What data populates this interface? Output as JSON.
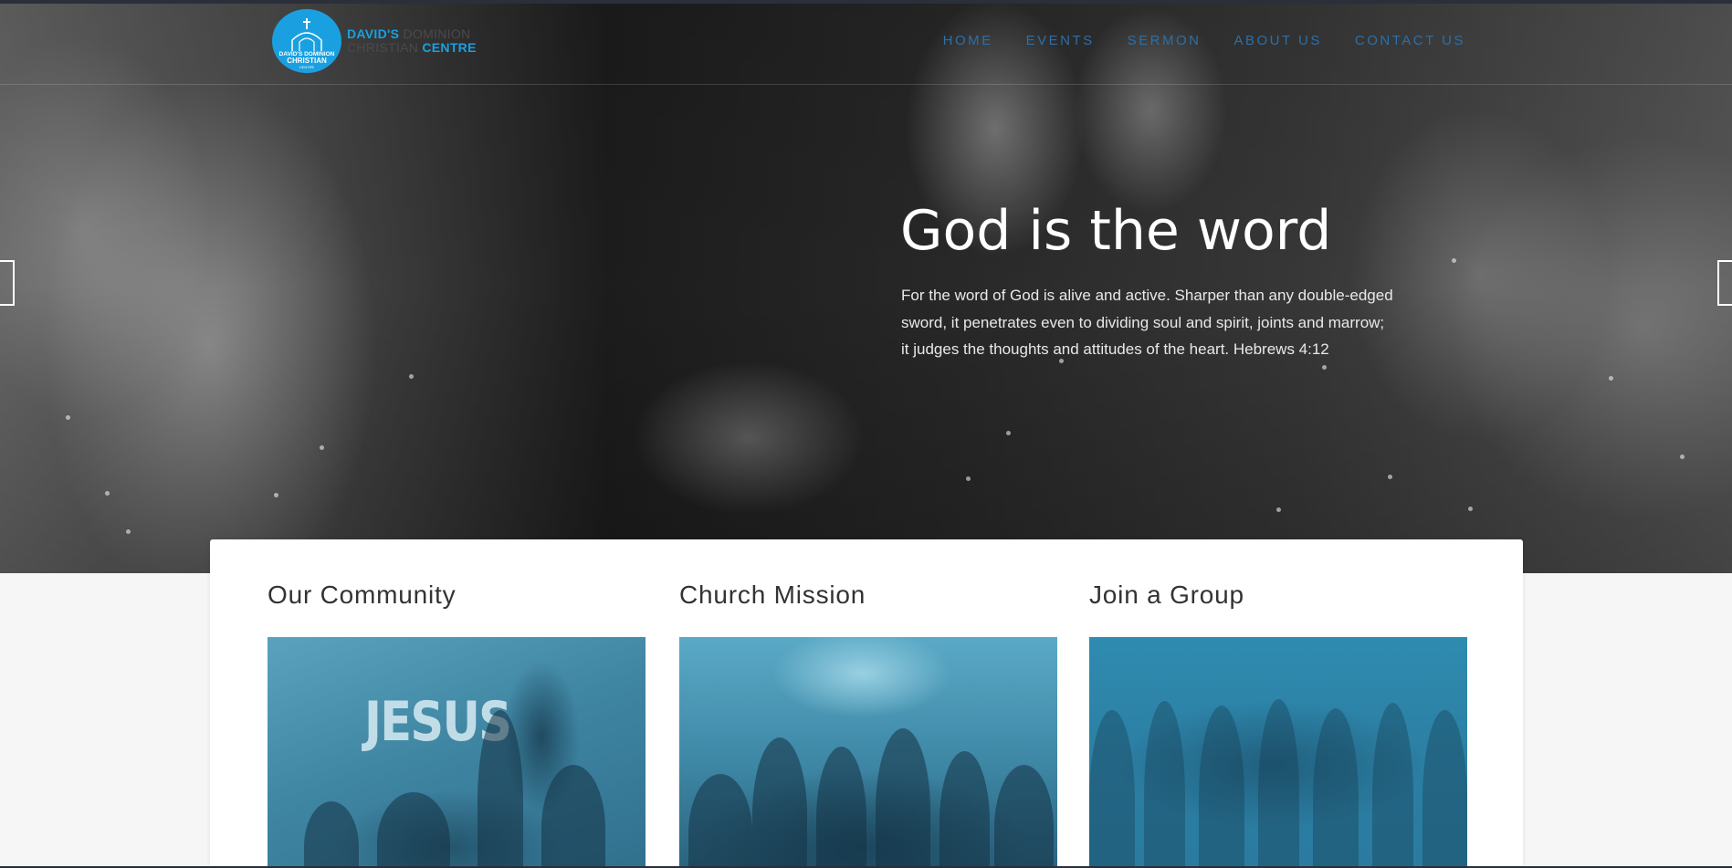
{
  "brand": {
    "line1_a": "DAVID'S",
    "line1_b": "DOMINION",
    "line2_a": "CHRISTIAN",
    "line2_b": "CENTRE",
    "badge_top": "DAVID'S DOMINION",
    "badge_mid": "CHRISTIAN",
    "badge_bottom": "CENTRE"
  },
  "nav": {
    "items": [
      {
        "label": "HOME"
      },
      {
        "label": "EVENTS"
      },
      {
        "label": "SERMON"
      },
      {
        "label": "ABOUT US"
      },
      {
        "label": "CONTACT US"
      }
    ]
  },
  "hero": {
    "title": "God is the word",
    "text": "For the word of God is alive and active. Sharper than any double-edged sword, it penetrates even to dividing soul and spirit, joints and marrow; it judges the thoughts and attitudes of the heart. Hebrews 4:12"
  },
  "cards": [
    {
      "title": "Our Community",
      "image_text": "JESUS"
    },
    {
      "title": "Church Mission"
    },
    {
      "title": "Join a Group"
    }
  ],
  "colors": {
    "accent": "#1aa0e0",
    "nav": "#2d6fa6",
    "card_tint": "#3e88a6"
  }
}
